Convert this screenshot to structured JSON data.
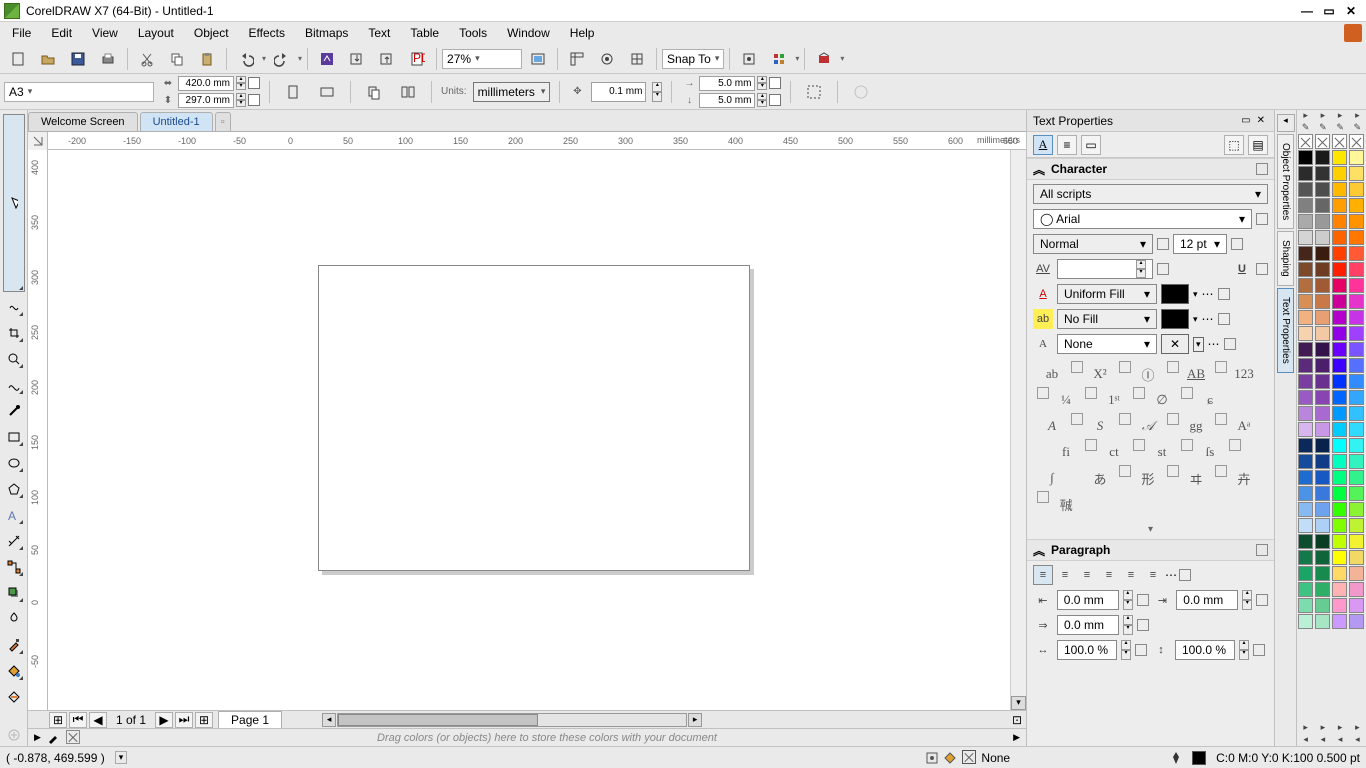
{
  "title": "CorelDRAW X7 (64-Bit) - Untitled-1",
  "menu": [
    "File",
    "Edit",
    "View",
    "Layout",
    "Object",
    "Effects",
    "Bitmaps",
    "Text",
    "Table",
    "Tools",
    "Window",
    "Help"
  ],
  "toolbar": {
    "zoom": "27%",
    "snap_to": "Snap To"
  },
  "propbar": {
    "page_preset": "A3",
    "width": "420.0 mm",
    "height": "297.0 mm",
    "units_label": "Units:",
    "units": "millimeters",
    "nudge": "0.1 mm",
    "dup_x": "5.0 mm",
    "dup_y": "5.0 mm"
  },
  "doc_tabs": {
    "welcome": "Welcome Screen",
    "active": "Untitled-1"
  },
  "ruler": {
    "h_ticks": [
      "-200",
      "-150",
      "-100",
      "-50",
      "0",
      "50",
      "100",
      "150",
      "200",
      "250",
      "300",
      "350",
      "400",
      "450",
      "500",
      "550",
      "600",
      "650"
    ],
    "h_unit_label": "millimeters",
    "v_ticks": [
      "400",
      "350",
      "300",
      "250",
      "200",
      "150",
      "100",
      "50",
      "0",
      "-50"
    ],
    "v_unit_label": "millimeters"
  },
  "page_nav": {
    "counter": "1 of 1",
    "page_tab": "Page 1"
  },
  "color_tray_msg": "Drag colors (or objects) here to store these colors with your document",
  "dock": {
    "title": "Text Properties",
    "char_section": "Character",
    "para_section": "Paragraph",
    "script": "All scripts",
    "font": "Arial",
    "weight": "Normal",
    "size": "12 pt",
    "fill_type": "Uniform Fill",
    "bg_fill": "No Fill",
    "outline_type": "None",
    "indent_left": "0.0 mm",
    "indent_right": "0.0 mm",
    "first_line": "0.0 mm",
    "scale_h": "100.0 %",
    "scale_v": "100.0 %"
  },
  "side_tabs": [
    "Object Properties",
    "Shaping",
    "Text Properties"
  ],
  "status": {
    "coords": "( -0.878, 469.599 )",
    "fill_label": "None",
    "outline_info": "C:0 M:0 Y:0 K:100  0.500 pt"
  },
  "palette_cols": [
    [
      "#ffffffX",
      "#000000",
      "#2b2b2b",
      "#555555",
      "#808080",
      "#aaaaaa",
      "#d4d4d4",
      "#46261b",
      "#7c4a2a",
      "#b26e3f",
      "#d88f55",
      "#f1b280",
      "#f6d2af",
      "#421a54",
      "#5c2a7a",
      "#7a3ea0",
      "#9a5ac4",
      "#b985dd",
      "#d7b6ef",
      "#0b2a5b",
      "#144b9c",
      "#1e6cd0",
      "#4a93e6",
      "#86baf0",
      "#c2ddf8",
      "#0b4d2e",
      "#13794a",
      "#1aa566",
      "#3fc383",
      "#7cdcad",
      "#b9f0d6"
    ],
    [
      "#ffffffX",
      "#1a1a1a",
      "#333333",
      "#4d4d4d",
      "#666666",
      "#999999",
      "#cccccc",
      "#3b1d0f",
      "#6e3c22",
      "#a05b35",
      "#c97948",
      "#e6a073",
      "#f2c8a5",
      "#33134a",
      "#4c1f6c",
      "#6a308f",
      "#8845b2",
      "#a869d0",
      "#c897e6",
      "#08224b",
      "#103d86",
      "#1858c2",
      "#3a78db",
      "#6fa2ec",
      "#aed0f6",
      "#093d24",
      "#106439",
      "#178a4e",
      "#2eae67",
      "#66cc91",
      "#a6e6c4"
    ],
    [
      "#ffffffX",
      "#ffe600",
      "#ffd000",
      "#ffb800",
      "#ff9e00",
      "#ff8200",
      "#ff6300",
      "#ff4000",
      "#ff1f00",
      "#e60066",
      "#cc0099",
      "#b300cc",
      "#9200e6",
      "#6c00ff",
      "#3d00ff",
      "#0033ff",
      "#0066ff",
      "#0099ff",
      "#00ccff",
      "#00ffff",
      "#00ffbf",
      "#00ff80",
      "#00ff40",
      "#33ff00",
      "#80ff00",
      "#bfff00",
      "#ffff00",
      "#ffd966",
      "#ffb3b3",
      "#ff99cc",
      "#cc99ff"
    ],
    [
      "#ffffffX",
      "#fff799",
      "#ffe066",
      "#ffc933",
      "#ffb000",
      "#ff9400",
      "#ff7700",
      "#ff5a33",
      "#ff4066",
      "#ff3399",
      "#e633cc",
      "#c733e6",
      "#a040ff",
      "#7a55ff",
      "#5570ff",
      "#338cff",
      "#33a6ff",
      "#33c0ff",
      "#33daff",
      "#33f2f2",
      "#33f2bf",
      "#33f28c",
      "#55f259",
      "#8cf233",
      "#bff233",
      "#f2f233",
      "#f2d966",
      "#f2b399",
      "#f299cc",
      "#d999f2",
      "#b399f2"
    ]
  ]
}
